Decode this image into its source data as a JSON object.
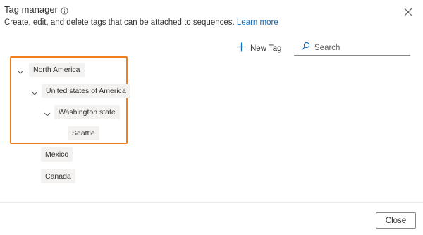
{
  "dialog": {
    "title": "Tag manager",
    "subtitle_text": "Create, edit, and delete tags that can be attached to sequences.",
    "learn_more": "Learn more",
    "close_icon": "close-icon",
    "info_icon": "info-icon"
  },
  "toolbar": {
    "new_tag_label": "New Tag",
    "new_tag_icon": "plus-icon",
    "search_placeholder": "Search",
    "search_icon": "search-icon"
  },
  "tree": {
    "north_america": "North America",
    "usa": "United states of America",
    "washington": "Washington state",
    "seattle": "Seattle",
    "mexico": "Mexico",
    "canada": "Canada"
  },
  "footer": {
    "close_label": "Close"
  },
  "colors": {
    "accent": "#0f6cbd",
    "highlight": "#f0801e",
    "chip_bg": "#f3f2f1"
  }
}
